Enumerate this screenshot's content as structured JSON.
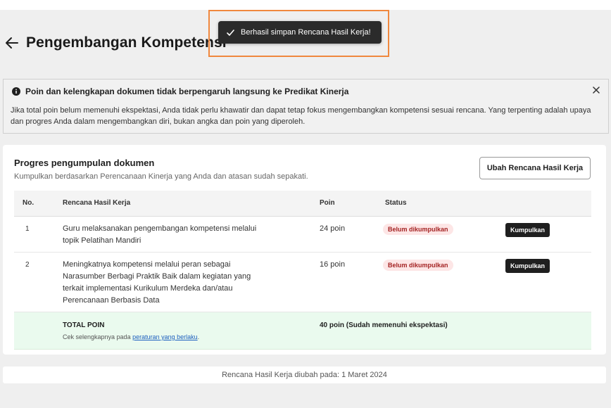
{
  "page": {
    "title": "Pengembangan Kompetensi"
  },
  "toast": {
    "message": "Berhasil simpan Rencana Hasil Kerja!"
  },
  "info": {
    "title": "Poin dan kelengkapan dokumen tidak berpengaruh langsung ke Predikat Kinerja",
    "body": "Jika total poin belum memenuhi ekspektasi, Anda tidak perlu khawatir dan dapat tetap fokus mengembangkan kompetensi sesuai rencana. Yang terpenting adalah upaya dan progres Anda dalam mengembangkan diri, bukan angka dan poin yang diperoleh."
  },
  "progress": {
    "title": "Progres pengumpulan dokumen",
    "subtitle": "Kumpulkan berdasarkan Perencanaan Kinerja yang Anda dan atasan sudah sepakati.",
    "edit_button": "Ubah Rencana Hasil Kerja",
    "columns": {
      "no": "No.",
      "plan": "Rencana Hasil Kerja",
      "points": "Poin",
      "status": "Status"
    },
    "rows": [
      {
        "no": "1",
        "plan": "Guru melaksanakan pengembangan kompetensi melalui topik Pelatihan Mandiri",
        "points": "24 poin",
        "status": "Belum dikumpulkan",
        "action": "Kumpulkan"
      },
      {
        "no": "2",
        "plan": "Meningkatnya kompetensi melalui peran sebagai Narasumber Berbagi Praktik Baik dalam kegiatan yang terkait implementasi Kurikulum Merdeka dan/atau Perencanaan Berbasis Data",
        "points": "16 poin",
        "status": "Belum dikumpulkan",
        "action": "Kumpulkan"
      }
    ],
    "total": {
      "label": "TOTAL POIN",
      "note_prefix": "Cek selengkapnya pada ",
      "note_link": "peraturan yang berlaku",
      "note_suffix": ".",
      "value": "40 poin (Sudah memenuhi ekspektasi)"
    }
  },
  "footer": {
    "text": "Rencana Hasil Kerja diubah pada: 1 Maret 2024"
  }
}
